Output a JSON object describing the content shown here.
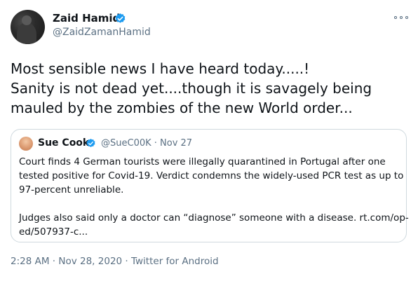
{
  "tweet": {
    "author_name": "Zaid Hamid",
    "author_handle": "@ZaidZamanHamid",
    "text_lines": [
      "Most sensible news I have heard today.....!",
      "Sanity is not dead yet....though it is savagely being",
      "mauled by the zombies of the new World order..."
    ],
    "timestamp": "2:28 AM · Nov 28, 2020 · Twitter for Android"
  },
  "quote": {
    "author_name": "Sue Cook",
    "meta": "@SueC00K · Nov 27",
    "lines": [
      "Court finds 4 German tourists were illegally quarantined in Portugal after one",
      "tested positive for Covid-19. Verdict condemns the widely-used PCR test as up to",
      "97-percent unreliable.",
      "Judges also said only a doctor can “diagnose” someone with a disease. rt.com/op-",
      "ed/507937-c..."
    ]
  },
  "icons": {
    "verified": "verified-badge-icon",
    "more": "more-options-icon"
  },
  "colors": {
    "verified_blue": "#1d9bf0",
    "secondary_text": "#5b7083",
    "border": "#cfd9de"
  }
}
